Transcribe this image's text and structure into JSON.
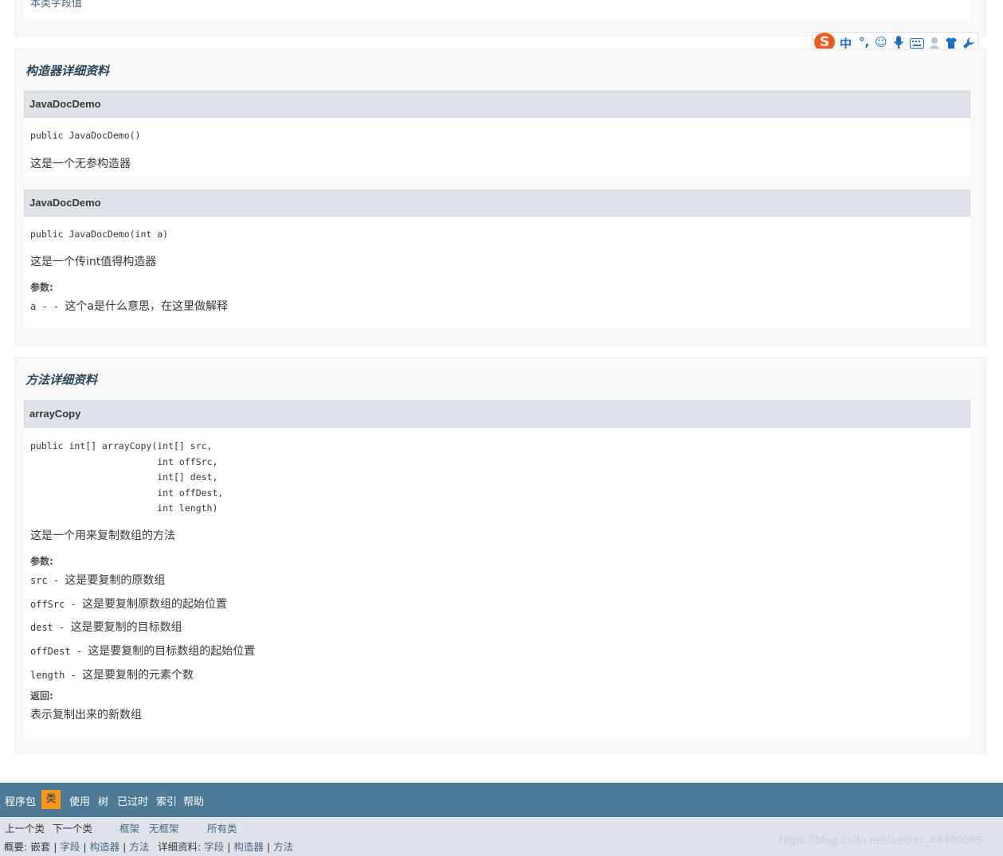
{
  "top_section": {
    "text": "本类字段值"
  },
  "ime_toolbar": {
    "logo": "S",
    "items": [
      "中",
      "°,",
      "☺",
      "🎤",
      "⌨",
      "👤",
      "👕",
      "🔧"
    ]
  },
  "constructor_section": {
    "title": "构造器详细资料",
    "members": [
      {
        "name": "JavaDocDemo",
        "signature": "public JavaDocDemo()",
        "description": "这是一个无参构造器"
      },
      {
        "name": "JavaDocDemo",
        "signature": "public JavaDocDemo(int a)",
        "description": "这是一个传int值得构造器",
        "params_label": "参数:",
        "params": [
          {
            "name": "a",
            "sep": " - - ",
            "text": "这个a是什么意思，在这里做解释"
          }
        ]
      }
    ]
  },
  "method_section": {
    "title": "方法详细资料",
    "members": [
      {
        "name": "arrayCopy",
        "signature": "public int[] arrayCopy(int[] src,\n                       int offSrc,\n                       int[] dest,\n                       int offDest,\n                       int length)",
        "description": "这是一个用来复制数组的方法",
        "params_label": "参数:",
        "params": [
          {
            "name": "src",
            "sep": " - ",
            "text": "这是要复制的原数组"
          },
          {
            "name": "offSrc",
            "sep": " - ",
            "text": "这是要复制原数组的起始位置"
          },
          {
            "name": "dest",
            "sep": " - ",
            "text": "这是要复制的目标数组"
          },
          {
            "name": "offDest",
            "sep": " - ",
            "text": "这是要复制的目标数组的起始位置"
          },
          {
            "name": "length",
            "sep": " - ",
            "text": "这是要复制的元素个数"
          }
        ],
        "returns_label": "返回:",
        "returns_text": "表示复制出来的新数组"
      }
    ]
  },
  "bottom_nav": {
    "items": [
      "程序包",
      "类",
      "使用",
      "树",
      "已过时",
      "索引",
      "帮助"
    ],
    "active": "类"
  },
  "sub_nav": {
    "prev_class": "上一个类",
    "next_class": "下一个类",
    "frames": "框架",
    "no_frames": "无框架",
    "all_classes": "所有类",
    "summary_label": "概要:",
    "summary_nested": "嵌套",
    "summary_field": "字段",
    "summary_constr": "构造器",
    "summary_method": "方法",
    "detail_label": "详细资料:",
    "detail_field": "字段",
    "detail_constr": "构造器",
    "detail_method": "方法",
    "sep": "|"
  },
  "watermark": "https://blog.csdn.net/weixin_44439085",
  "colors": {
    "nav_bg": "#4d7a97",
    "nav_active": "#f8981d",
    "member_header": "#dee3e9",
    "section_bg": "#f8f8f8",
    "link": "#4a6782"
  }
}
